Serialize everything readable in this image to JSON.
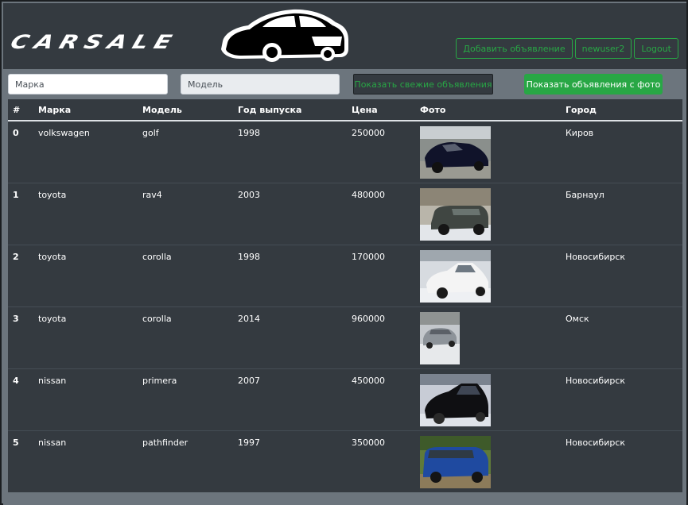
{
  "header": {
    "logo_text": "CARSALE",
    "buttons": [
      {
        "label": "Добавить объявление"
      },
      {
        "label": "newuser2"
      },
      {
        "label": "Logout"
      }
    ]
  },
  "filters": {
    "brand_placeholder": "Марка",
    "model_placeholder": "Модель",
    "fresh_button": "Показать свежие объявления",
    "photo_button": "Показать объявления с фото"
  },
  "table": {
    "columns": [
      "#",
      "Марка",
      "Модель",
      "Год выпуска",
      "Цена",
      "Фото",
      "Город"
    ],
    "rows": [
      {
        "idx": "0",
        "brand": "volkswagen",
        "model": "golf",
        "year": "1998",
        "price": "250000",
        "city": "Киров"
      },
      {
        "idx": "1",
        "brand": "toyota",
        "model": "rav4",
        "year": "2003",
        "price": "480000",
        "city": "Барнаул"
      },
      {
        "idx": "2",
        "brand": "toyota",
        "model": "corolla",
        "year": "1998",
        "price": "170000",
        "city": "Новосибирск"
      },
      {
        "idx": "3",
        "brand": "toyota",
        "model": "corolla",
        "year": "2014",
        "price": "960000",
        "city": "Омск"
      },
      {
        "idx": "4",
        "brand": "nissan",
        "model": "primera",
        "year": "2007",
        "price": "450000",
        "city": "Новосибирск"
      },
      {
        "idx": "5",
        "brand": "nissan",
        "model": "pathfinder",
        "year": "1997",
        "price": "350000",
        "city": "Новосибирск"
      }
    ]
  },
  "colors": {
    "accent": "#28a745",
    "header_bg": "#343a40",
    "page_bg": "#6c757d"
  }
}
